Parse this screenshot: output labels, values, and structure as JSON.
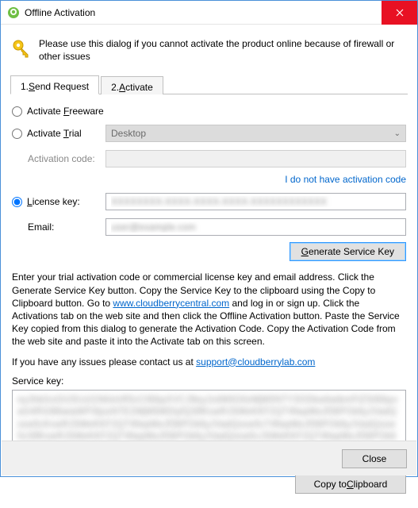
{
  "window": {
    "title": "Offline Activation"
  },
  "hint": "Please use this dialog if you cannot activate the product online because of firewall or other issues",
  "tabs": {
    "send_request_prefix": "1. ",
    "send_request_u": "S",
    "send_request_suffix": "end Request",
    "activate_prefix": "2. ",
    "activate_u": "A",
    "activate_suffix": "ctivate"
  },
  "options": {
    "freeware_prefix": "Activate ",
    "freeware_u": "F",
    "freeware_suffix": "reeware",
    "trial_prefix": "Activate ",
    "trial_u": "T",
    "trial_suffix": "rial",
    "license_u": "L",
    "license_suffix": "icense key:",
    "trial_dropdown": "Desktop"
  },
  "fields": {
    "activation_code_label": "Activation code:",
    "activation_code_value": "",
    "license_key_value": "XXXXXXXX-XXXX-XXXX-XXXX-XXXXXXXXXXXX",
    "email_label": "Email:",
    "email_value": "user@example.com"
  },
  "links": {
    "no_activation_code": "I do not have activation code",
    "cloudberry_central": "www.cloudberrycentral.com",
    "support_email": "support@cloudberrylab.com"
  },
  "buttons": {
    "generate_prefix": "",
    "generate_u": "G",
    "generate_suffix": "enerate Service Key",
    "copy_prefix": "Copy to ",
    "copy_u": "C",
    "copy_suffix": "lipboard",
    "close": "Close"
  },
  "instructions": {
    "part1": "Enter your trial activation code or commercial license key and email address. Click the Generate Service Key button. Copy the Service Key to the clipboard using the Copy to Clipboard button. Go to ",
    "part2": " and log in or sign up. Click the Activations tab on the web site and then click the Offline Activation button. Paste the Service Key copied from this dialog to generate the Activation Code. Copy the Activation Code from the web site and paste it into the Activate tab on this screen."
  },
  "issues_text": "If you have any issues please contact us at ",
  "service_key_label": "Service key:",
  "service_key_value": "eyJhbGciOiJSUzI1NiIsInR5cCI6IkpXVCJ9eyJzdWIiOiIxMjM0NTY3ODkwIiwibmFtZSI6IkpvaG4RG9lIiwiaWF0IjoxNTE2MjM5MDIyfQSflKxwRJSMeKKF2QT4fwpMeJf36POk6yJVadQssw5cKxwRJSMeKKF2QT4fwpMeJf36POk6yJVadQssw5cT4fwpMeJf36POk6yJVadQssw5cSflKxwRJSMeKKF2QT4fwpMeJf36POk6yJVadQssw5cJSMeKKF2QT4fwpMeJf36POk6yJVadQssw5cKxwRJSMeKKF2QT4fwpMeJf36POk6yJVadQss"
}
